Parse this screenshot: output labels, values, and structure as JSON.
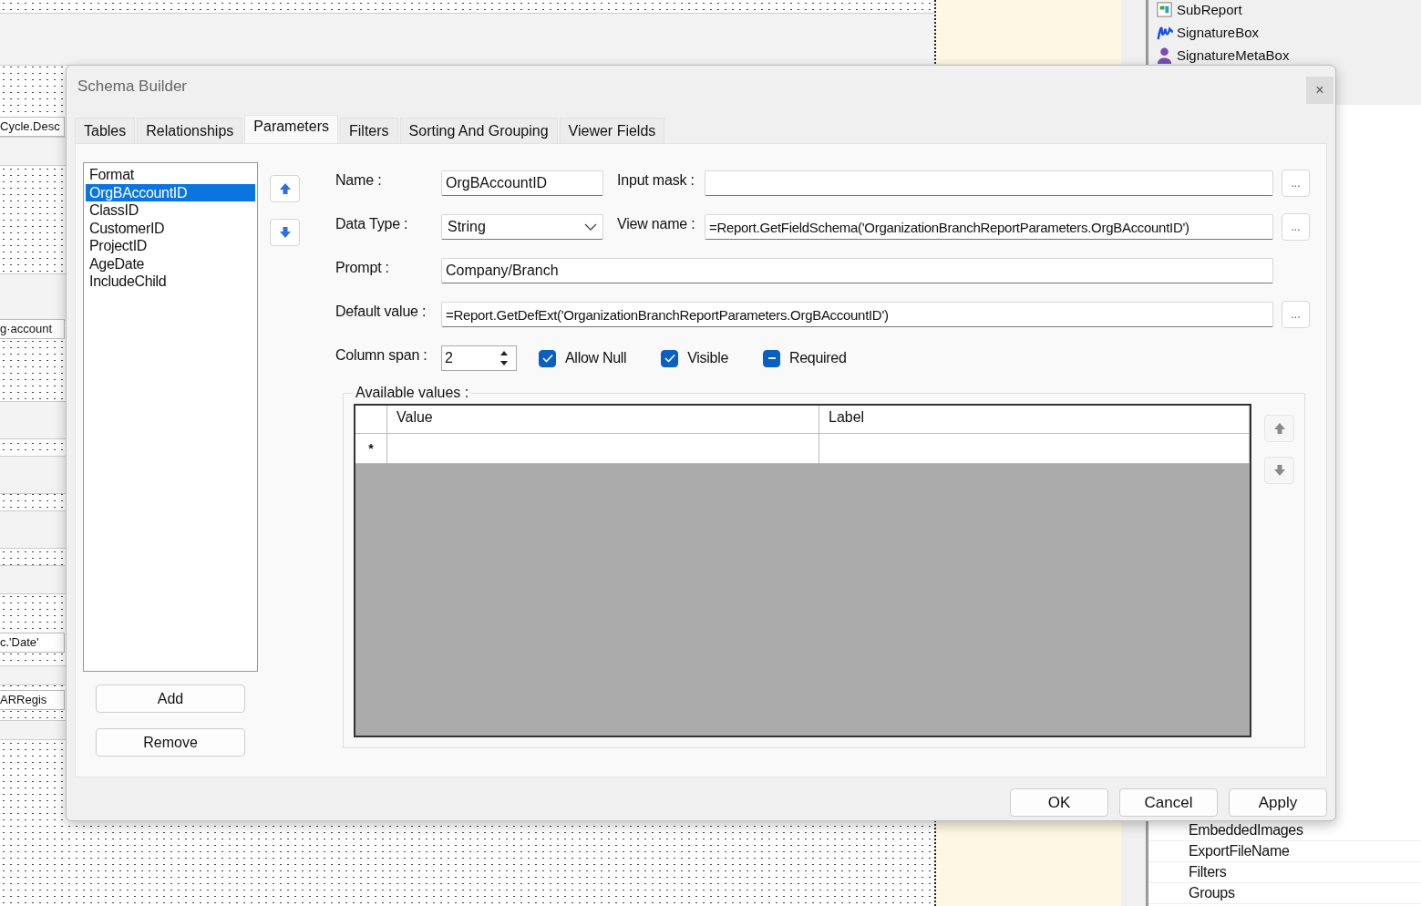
{
  "designer": {
    "fields": [
      "Cycle.Desc",
      "g·account",
      "c.'Date'",
      "ARRegis"
    ]
  },
  "toolbox": {
    "items": [
      {
        "label": "SubReport",
        "kind": "report"
      },
      {
        "label": "SignatureBox",
        "kind": "signature"
      },
      {
        "label": "SignatureMetaBox",
        "kind": "person"
      }
    ]
  },
  "properties": {
    "rows": [
      "EmbeddedImages",
      "ExportFileName",
      "Filters",
      "Groups"
    ]
  },
  "dialog": {
    "title": "Schema Builder",
    "close": "×",
    "tabs": [
      {
        "label": "Tables",
        "selected": false
      },
      {
        "label": "Relationships",
        "selected": false
      },
      {
        "label": "Parameters",
        "selected": true
      },
      {
        "label": "Filters",
        "selected": false
      },
      {
        "label": "Sorting And Grouping",
        "selected": false
      },
      {
        "label": "Viewer Fields",
        "selected": false
      }
    ],
    "parameters": [
      {
        "label": "Format",
        "selected": false
      },
      {
        "label": "OrgBAccountID",
        "selected": true
      },
      {
        "label": "ClassID",
        "selected": false
      },
      {
        "label": "CustomerID",
        "selected": false
      },
      {
        "label": "ProjectID",
        "selected": false
      },
      {
        "label": "AgeDate",
        "selected": false
      },
      {
        "label": "IncludeChild",
        "selected": false
      }
    ],
    "add": "Add",
    "remove": "Remove",
    "form": {
      "name_label": "Name :",
      "name": "OrgBAccountID",
      "input_mask_label": "Input mask :",
      "input_mask_button": "...",
      "data_type_label": "Data Type :",
      "data_type": "String",
      "view_name_label": "View name :",
      "view_name": "=Report.GetFieldSchema('OrganizationBranchReportParameters.OrgBAccountID')",
      "view_name_button": "...",
      "prompt_label": "Prompt :",
      "prompt": "Company/Branch",
      "default_value_label": "Default value :",
      "default_value": "=Report.GetDefExt('OrganizationBranchReportParameters.OrgBAccountID')",
      "default_value_button": "...",
      "column_span_label": "Column span :",
      "column_span": "2",
      "options": [
        {
          "label": "Allow Null",
          "checked": true,
          "indeterminate": false
        },
        {
          "label": "Visible",
          "checked": true,
          "indeterminate": false
        },
        {
          "label": "Required",
          "checked": true,
          "indeterminate": true
        }
      ]
    },
    "available_values": {
      "legend": "Available values :",
      "columns": [
        "Value",
        "Label"
      ],
      "new_row_marker": "*"
    },
    "buttons": [
      "OK",
      "Cancel",
      "Apply"
    ]
  }
}
